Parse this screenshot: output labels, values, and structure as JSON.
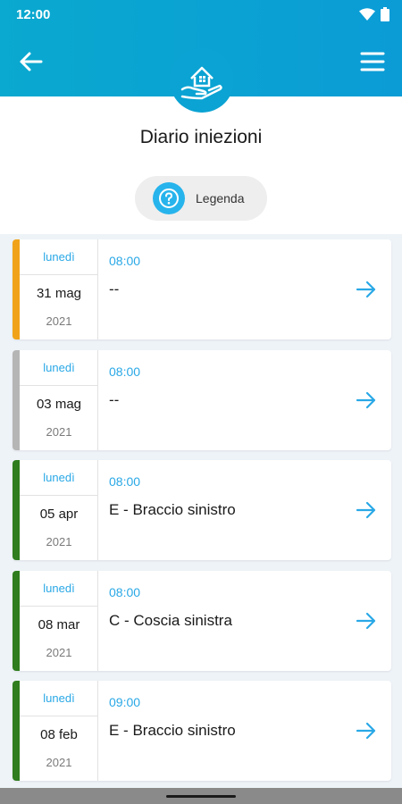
{
  "status_bar": {
    "time": "12:00"
  },
  "header": {
    "back_icon": "arrow-left-icon",
    "menu_icon": "hamburger-menu-icon",
    "logo_icon": "house-in-hand-icon"
  },
  "page": {
    "title": "Diario iniezioni"
  },
  "legend": {
    "label": "Legenda",
    "icon": "question-circle-icon"
  },
  "colors": {
    "header": "#0aa9cf",
    "accent": "#29a8e6",
    "status_orange": "#f0a31a",
    "status_grey": "#b5b5b5",
    "status_green": "#2f7d1e"
  },
  "entries": [
    {
      "weekday": "lunedì",
      "date": "31 mag",
      "year": "2021",
      "time": "08:00",
      "site": "--",
      "status_color": "#f0a31a"
    },
    {
      "weekday": "lunedì",
      "date": "03 mag",
      "year": "2021",
      "time": "08:00",
      "site": "--",
      "status_color": "#b5b5b5"
    },
    {
      "weekday": "lunedì",
      "date": "05 apr",
      "year": "2021",
      "time": "08:00",
      "site": "E - Braccio sinistro",
      "status_color": "#2f7d1e"
    },
    {
      "weekday": "lunedì",
      "date": "08 mar",
      "year": "2021",
      "time": "08:00",
      "site": "C - Coscia sinistra",
      "status_color": "#2f7d1e"
    },
    {
      "weekday": "lunedì",
      "date": "08 feb",
      "year": "2021",
      "time": "09:00",
      "site": "E - Braccio sinistro",
      "status_color": "#2f7d1e"
    }
  ]
}
